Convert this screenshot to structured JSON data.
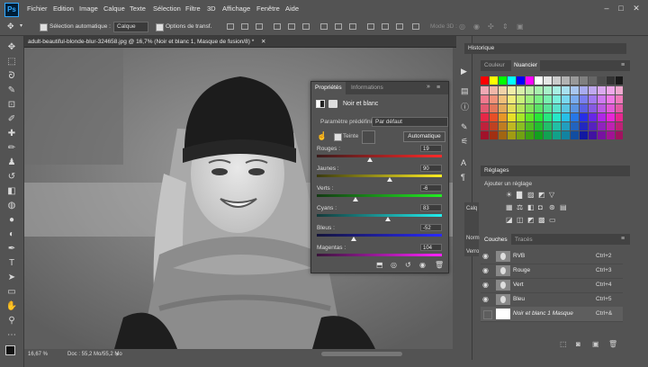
{
  "menubar": {
    "items": [
      "Fichier",
      "Edition",
      "Image",
      "Calque",
      "Texte",
      "Sélection",
      "Filtre",
      "3D",
      "Affichage",
      "Fenêtre",
      "Aide"
    ],
    "app_logo": "Ps"
  },
  "options_bar": {
    "auto_select_label": "Sélection automatique :",
    "auto_select_value": "Calque",
    "transform_label": "Options de transf.",
    "mode3d_label": "Mode 3D :"
  },
  "document": {
    "tab_title": "adult-beautiful-blonde-blur-324658.jpg @ 16,7% (Noir et blanc 1, Masque de fusion/8) *",
    "zoom": "16,67 %",
    "doc_info": "Doc : 55,2 Mo/55,2 Mo"
  },
  "properties": {
    "tabs": [
      "Propriétés",
      "Informations"
    ],
    "title": "Noir et blanc",
    "preset_label": "Paramètre prédéfini :",
    "preset_value": "Par défaut",
    "tint_label": "Teinte",
    "auto_button": "Automatique",
    "sliders": [
      {
        "label": "Rouges :",
        "value": "19"
      },
      {
        "label": "Jaunes :",
        "value": "90"
      },
      {
        "label": "Verts :",
        "value": "-6"
      },
      {
        "label": "Cyans :",
        "value": "83"
      },
      {
        "label": "Bleus :",
        "value": "-52"
      },
      {
        "label": "Magentas :",
        "value": "104"
      }
    ]
  },
  "right": {
    "history_title": "Historique",
    "color_tabs": [
      "Couleur",
      "Nuancier"
    ],
    "adjust_title": "Réglages",
    "adjust_sub": "Ajouter un réglage",
    "layers_tabs": [
      "Couches",
      "Tracés"
    ],
    "side_tabs": [
      "Calq",
      "Norm",
      "Verro"
    ],
    "channels": [
      {
        "name": "RVB",
        "shortcut": "Ctrl+2"
      },
      {
        "name": "Rouge",
        "shortcut": "Ctrl+3"
      },
      {
        "name": "Vert",
        "shortcut": "Ctrl+4"
      },
      {
        "name": "Bleu",
        "shortcut": "Ctrl+5"
      },
      {
        "name": "Noir et blanc 1 Masque",
        "shortcut": "Ctrl+&"
      }
    ]
  },
  "colors": {
    "accent": "#31a8ff",
    "panel_bg": "#535353",
    "dark_bg": "#424242"
  }
}
